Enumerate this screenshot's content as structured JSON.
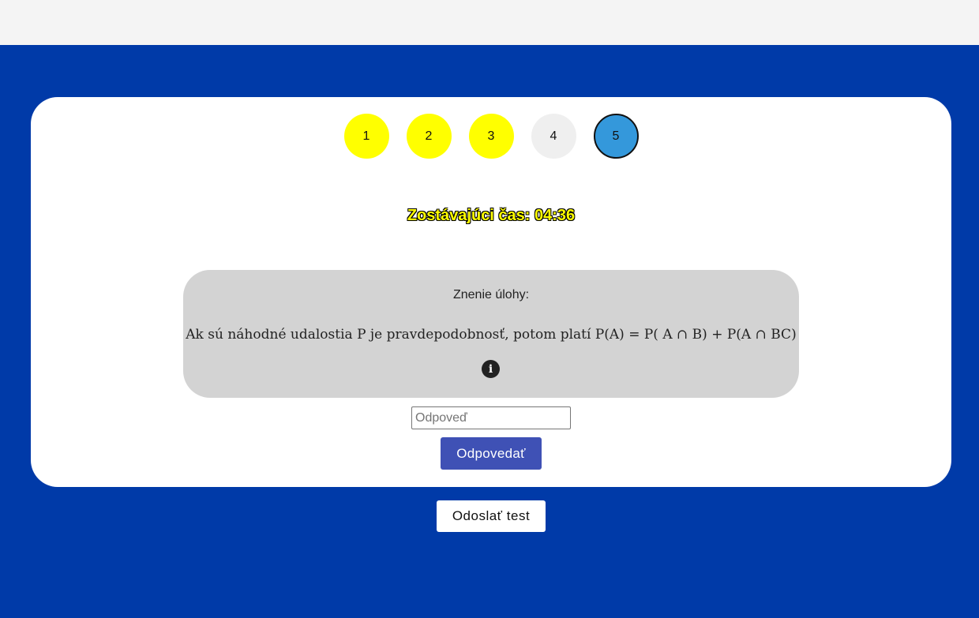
{
  "question_nav": [
    {
      "label": "1",
      "state": "answered"
    },
    {
      "label": "2",
      "state": "answered"
    },
    {
      "label": "3",
      "state": "answered"
    },
    {
      "label": "4",
      "state": "unanswered"
    },
    {
      "label": "5",
      "state": "current"
    }
  ],
  "timer": {
    "text": "Zostávajúci čas: 04:36"
  },
  "task": {
    "title": "Znenie úlohy:",
    "text": "Ak sú náhodné udalostia P je pravdepodobnosť, potom platí P(A) = P( A ∩ B) + P(A ∩ BC)",
    "info_icon": "info-icon"
  },
  "answer": {
    "placeholder": "Odpoveď",
    "value": "",
    "button_label": "Odpovedať"
  },
  "submit_test_label": "Odoslať test",
  "colors": {
    "background": "#003aa8",
    "answered": "#ffff00",
    "unanswered": "#efefef",
    "current": "#3498db",
    "task_box": "#d3d3d3",
    "answer_button": "#3f51b5",
    "timer": "#ffff00"
  }
}
